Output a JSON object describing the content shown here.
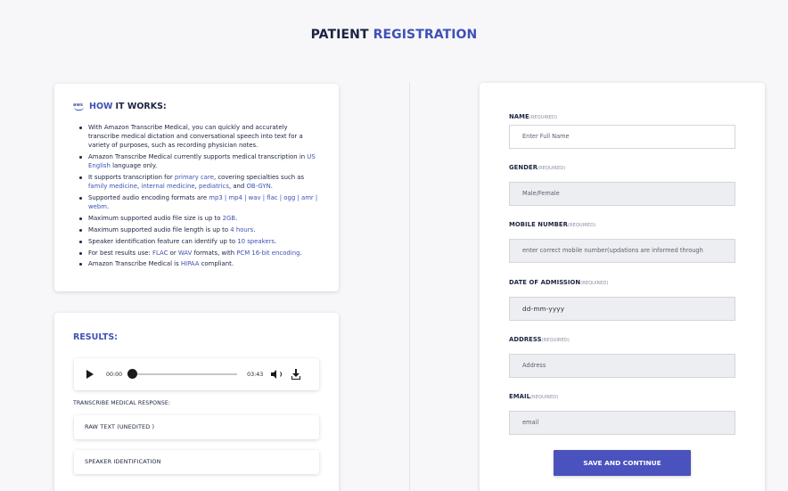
{
  "header": {
    "title_part1": "PATIENT",
    "title_part2": "REGISTRATION"
  },
  "how_it_works": {
    "logo_text": "aws",
    "title_accent": "HOW",
    "title_rest": "IT WORKS:",
    "items": [
      [
        "With Amazon Transcribe Medical, you can quickly and accurately transcribe medical dictation and conversational speech into text for a variety of purposes, such as recording physician notes."
      ],
      [
        "Amazon Transcribe Medical currently supports medical transcription in ",
        "US English",
        " language only."
      ],
      [
        "It supports transcription for ",
        "primary care",
        ", covering specialties such as ",
        "family medicine",
        ", ",
        "internal medicine",
        ", ",
        "pediatrics",
        ", and ",
        "OB-GYN",
        "."
      ],
      [
        "Supported audio encoding formats are ",
        "mp3 | mp4 | wav | flac | ogg | amr | webm",
        "."
      ],
      [
        "Maximum supported audio file size is up to ",
        "2GB",
        "."
      ],
      [
        "Maximum supported audio file length is up to ",
        "4 hours",
        "."
      ],
      [
        "Speaker identification feature can identify up to ",
        "10 speakers",
        "."
      ],
      [
        "For best results use: ",
        "FLAC",
        " or ",
        "WAV",
        " formats, with ",
        "PCM 16-bit encoding",
        "."
      ],
      [
        "Amazon Transcribe Medical is ",
        "HIPAA",
        " compliant."
      ]
    ]
  },
  "results": {
    "title": "RESULTS:",
    "player": {
      "current_time": "00:00",
      "duration": "03:43",
      "progress": 0
    },
    "response_label": "TRANSCRIBE MEDICAL RESPONSE:",
    "raw_text_label": "RAW TEXT (UNEDITED )",
    "speaker_label": "SPEAKER IDENTIFICATION"
  },
  "form": {
    "required_tag": "(REQUIRED)",
    "name": {
      "label": "NAME",
      "placeholder": "Enter Full Name"
    },
    "gender": {
      "label": "GENDER",
      "value": "Male/Female"
    },
    "mobile": {
      "label": "MOBILE NUMBER",
      "value": "enter correct mobile number(updations are informed through"
    },
    "admission": {
      "label": "DATE OF ADMISSION",
      "value": "dd-mm-yyyy"
    },
    "address": {
      "label": "ADDRESS",
      "value": "Address"
    },
    "email": {
      "label": "EMAIL",
      "value": "email"
    },
    "submit_label": "SAVE AND CONTINUE"
  },
  "colors": {
    "accent": "#3f51b5",
    "button": "#4a52bd",
    "text_dark": "#1b2340"
  },
  "icons": [
    "aws-logo-icon",
    "play-icon",
    "seek-knob",
    "volume-icon",
    "download-icon"
  ]
}
